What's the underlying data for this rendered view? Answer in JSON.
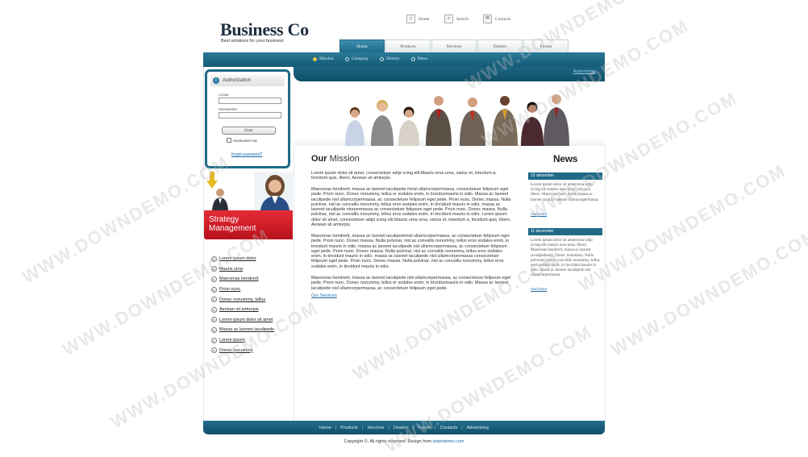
{
  "logo": {
    "title": "Business Co",
    "tagline": "Best solutions for your business"
  },
  "toplinks": [
    {
      "label": "Home",
      "icon": "home-icon",
      "glyph": "⌂"
    },
    {
      "label": "Search",
      "icon": "search-icon",
      "glyph": "⌕"
    },
    {
      "label": "Contacts",
      "icon": "contacts-icon",
      "glyph": "✉"
    }
  ],
  "tabs": [
    {
      "label": "Home",
      "active": true
    },
    {
      "label": "Products"
    },
    {
      "label": "Services"
    },
    {
      "label": "Dealers"
    },
    {
      "label": "Forum"
    }
  ],
  "subnav": [
    "Mission",
    "Company",
    "History",
    "News"
  ],
  "advertising": "Advertising",
  "auth": {
    "title": "Authorization",
    "login_label": "LOGIN",
    "password_label": "PASSWORD",
    "enter": "Enter",
    "remember": "REMEMBER ME",
    "forgot": "forgot password?"
  },
  "strategy": {
    "line1": "Strategy",
    "line2": "Management"
  },
  "sidelinks": [
    "Lorem ipsum dolor",
    "Mauris urna",
    "Maecenas hendrerit",
    "Proin nunc",
    "Donec nonummy, tellus",
    "Aenean sit amturpis",
    "Lorem ipsum dolor sit amet",
    "Massa ac laoreet iaculipede",
    "Lorem ipsum",
    "Donec nonummy"
  ],
  "mission": {
    "title_bold": "Our",
    "title_rest": " Mission",
    "p1": "Lorem ipsum dolor sit amet, consectetuer adipi scing elit.Mauris urna urna, varius et, interdum a, tincidunt quis, libero. Aenean sit amturpis.",
    "p2": "Maecenas hendrerit, massa ac laoreet iaculipede mnisl ullamcorpermassa, consectetuer felipsum eget pede. Proin nunc. Donec nonummy, tellus er sodales enim, in tincidunmauris in odio. Massa ac laoreet iaculipede nisl ullamcorpermassa, ac consectetuer felipsum eget pede. Proin nunc. Donec massa. Nulla pulvinar, nisl ac convallis nonummy, tellus eros sodales enim, in tincidunt mauris in odio. massa ac laoreet iaculipede nlorpermassa ac consectetuer felipsum eget pede. Proin nunc. Donec massa. Nulla pulvinar, nisl ac convallis nonummy, tellus eros sodales enim, in tincidunt mauris in odio. Lorem ipsum dolor sit amet, consectetuer adipi scing elit.Mauris urna urna, varius et, interdum a, tincidunt quis, libero. Aenean sit amturpis.",
    "p3": "Maecenas hendrerit, massa ac laoreet iaculipedenisl ullamcorpermassa, ac consectetuer felipsum eget pede. Proin nunc. Donec massa. Nulla pulvinar, nisl ac convallis nonummy, tellus eros sodales enim, in tincidunt mauris in odio. massa ac laoreet iaculipede nisl ullamcorpermassa, ac consectetuer felipsum eget pede. Proin nunc. Donec massa. Nulla pulvinar, nisl ac convallis nonummy, tellus eros sodales enim, in tincidunt mauris in odio. massa ac laoreet iaculipede nisl ullamcorpermassa consectetuer felipsum eget pede. Proin nunc. Donec massa. Nulla pulvinar, nisl ac convallis nonummy, tellus eros sodales enim, in tincidunt mauris in odio.",
    "p4": "Maecenas hendrerit, massa ac laoreet iaculipede nisl ullamcorpermassa, ac consectetuer felipsum eget pede. Proin nunc. Donec nonummy, tellus er sodales enim, in tincidunmauris in odio. Massa ac laoreet iaculipede nisl ullamcorpermassa, ac consectetuer felipsum eget pede.",
    "services": "Our Services"
  },
  "news": {
    "title_bold": "News",
    "items": [
      {
        "date": "23 december",
        "text": "Lorem ipsum dolor sit ametconse adip iscing elit mauris urna urna, orit quis, libero. Maecenas hen- drerit, massa ac laoreet iaculip- edenisl ullamcorpermassa.",
        "more": "read more"
      },
      {
        "date": "11 december",
        "text": "Lorem ipsum dolor sit ametconse adip iscing elit mauris urna urna. libero. Maecenas hendrerit, massa ac laoreet iaculipedenisl, Donec nonummy. Nulla pulvinar, nisl ac convallis nonummy, tellus eros sodales enim, in tincidunt mauris in odio. massa ac laoreet iaculipede nisl ullamcorpermassa.",
        "more": "read more"
      }
    ]
  },
  "footer": {
    "links": [
      "Home",
      "Products",
      "Services",
      "Dealers",
      "Forum",
      "Contacts",
      "Advertising"
    ],
    "copyright": "Copyright ©. All rights reserved. Design from ",
    "copyright_link": "downdemo.com"
  },
  "watermark": "WWW.DOWNDEMO.COM",
  "colors": {
    "primary": "#1f6a88",
    "accent_red": "#d21f2a",
    "link": "#1a6aaa"
  }
}
